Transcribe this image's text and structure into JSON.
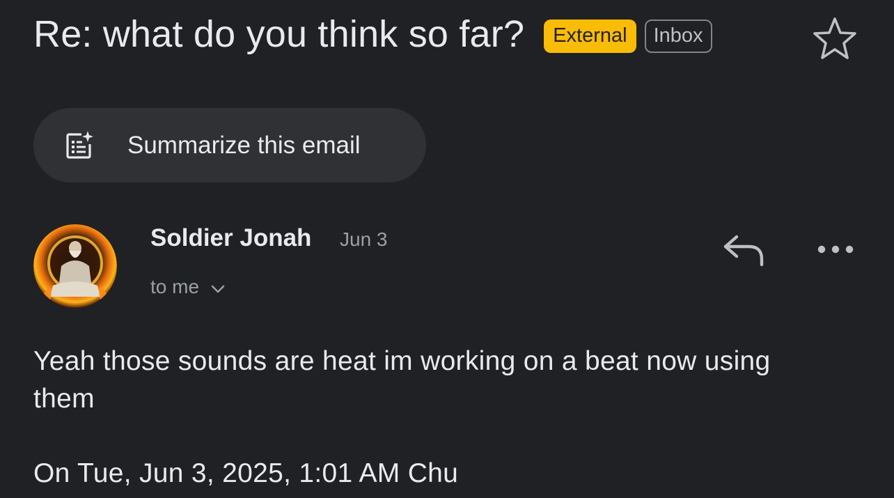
{
  "email": {
    "subject": "Re: what do you think so far?",
    "badges": {
      "external": "External",
      "inbox": "Inbox"
    },
    "star_icon": "star-outline-icon",
    "summarize_label": "Summarize this email",
    "summarize_icon": "summarize-doc-sparkle-icon",
    "sender": {
      "name": "Soldier Jonah",
      "date": "Jun 3",
      "recipient_label": "to me"
    },
    "actions": {
      "reply_icon": "reply-icon",
      "more_icon": "more-horizontal-icon"
    },
    "body": "Yeah those sounds are heat im working on a beat now using them",
    "quote_header": "On Tue, Jun 3, 2025, 1:01 AM Chu"
  },
  "colors": {
    "background": "#202124",
    "external_badge": "#fbbc04",
    "summarize_pill": "#303134"
  }
}
